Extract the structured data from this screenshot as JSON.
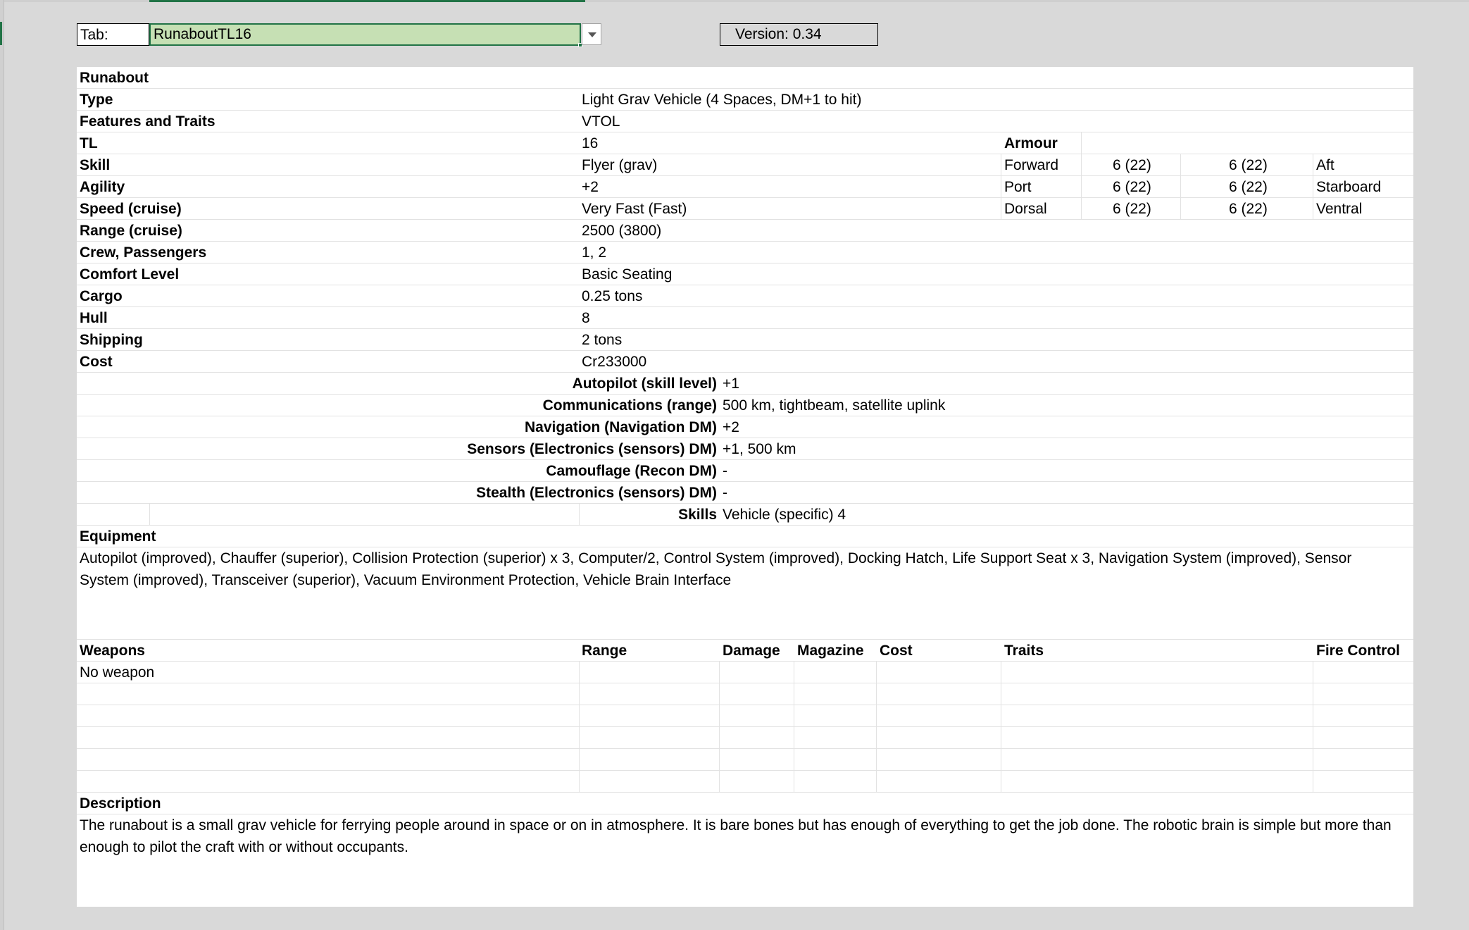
{
  "header": {
    "tab_label": "Tab:",
    "tab_value": "RunaboutTL16",
    "version": "Version: 0.34"
  },
  "title": "Runabout",
  "stats": [
    {
      "label": "Type",
      "value": "Light Grav Vehicle (4 Spaces, DM+1 to hit)"
    },
    {
      "label": "Features and Traits",
      "value": "VTOL"
    },
    {
      "label": "TL",
      "value": "16"
    },
    {
      "label": "Skill",
      "value": "Flyer (grav)"
    },
    {
      "label": "Agility",
      "value": "+2"
    },
    {
      "label": "Speed (cruise)",
      "value": "Very Fast (Fast)"
    },
    {
      "label": "Range (cruise)",
      "value": "2500 (3800)"
    },
    {
      "label": "Crew, Passengers",
      "value": "1, 2"
    },
    {
      "label": "Comfort Level",
      "value": "Basic Seating"
    },
    {
      "label": "Cargo",
      "value": "0.25 tons"
    },
    {
      "label": "Hull",
      "value": "8"
    },
    {
      "label": "Shipping",
      "value": "2 tons"
    },
    {
      "label": "Cost",
      "value": "Cr233000"
    }
  ],
  "armour": {
    "heading": "Armour",
    "rows": [
      {
        "side_a": "Forward",
        "value_a": "6 (22)",
        "value_b": "6 (22)",
        "side_b": "Aft"
      },
      {
        "side_a": "Port",
        "value_a": "6 (22)",
        "value_b": "6 (22)",
        "side_b": "Starboard"
      },
      {
        "side_a": "Dorsal",
        "value_a": "6 (22)",
        "value_b": "6 (22)",
        "side_b": "Ventral"
      }
    ]
  },
  "systems": [
    {
      "label": "Autopilot (skill level)",
      "value": "+1"
    },
    {
      "label": "Communications (range)",
      "value": "500 km, tightbeam, satellite uplink"
    },
    {
      "label": "Navigation (Navigation DM)",
      "value": "+2"
    },
    {
      "label": "Sensors (Electronics (sensors) DM)",
      "value": "+1, 500 km"
    },
    {
      "label": "Camouflage (Recon DM)",
      "value": "-"
    },
    {
      "label": "Stealth (Electronics (sensors) DM)",
      "value": "-"
    },
    {
      "label": "Skills",
      "value": "Vehicle (specific) 4"
    }
  ],
  "equipment": {
    "heading": "Equipment",
    "text": "Autopilot (improved), Chauffer (superior), Collision Protection (superior) x 3, Computer/2, Control System (improved), Docking Hatch, Life Support Seat x 3, Navigation System (improved), Sensor System (improved), Transceiver (superior), Vacuum Environment Protection, Vehicle Brain Interface"
  },
  "weapons": {
    "headers": {
      "weapons": "Weapons",
      "range": "Range",
      "damage": "Damage",
      "magazine": "Magazine",
      "cost": "Cost",
      "traits": "Traits",
      "fire_control": "Fire Control"
    },
    "first_row": "No weapon"
  },
  "description": {
    "heading": "Description",
    "text": "The runabout is a small grav vehicle for ferrying people around in space or on in atmosphere. It is bare bones but has enough of everything to get the job done. The robotic brain is simple but more than enough to pilot the craft with or without occupants."
  }
}
